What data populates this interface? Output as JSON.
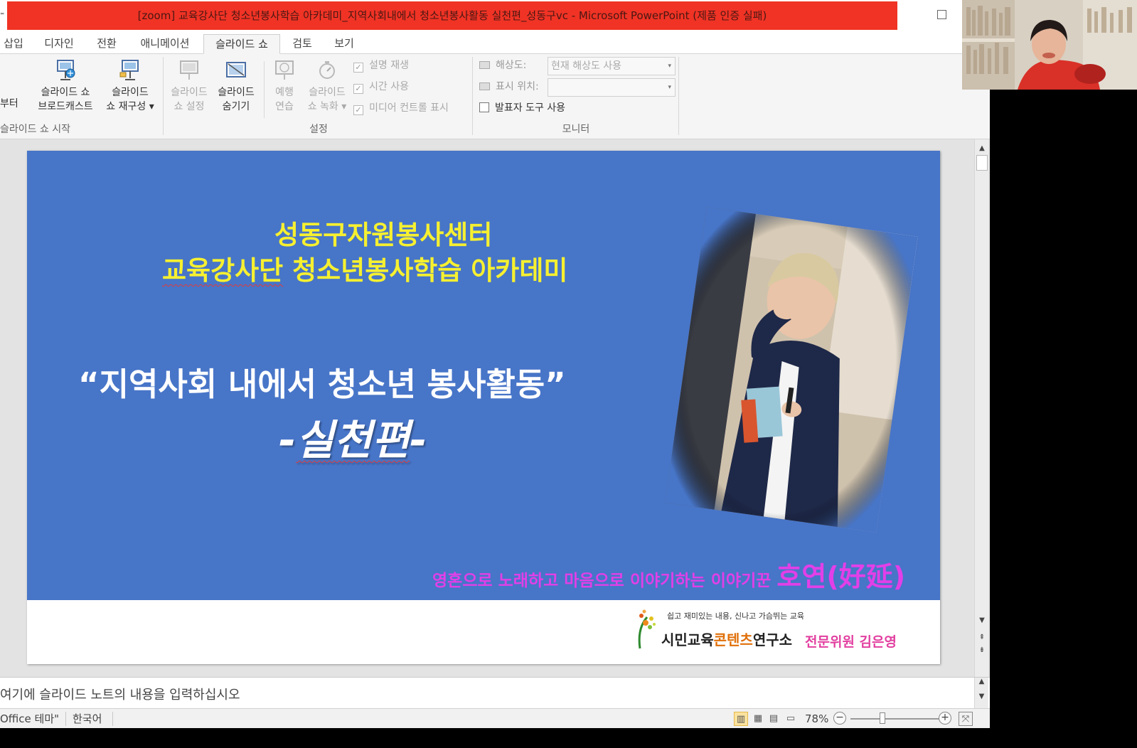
{
  "window": {
    "title": "[zoom] 교육강사단 청소년봉사학습 아카데미_지역사회내에서 청소년봉사활동 실천편_성동구vc  -  Microsoft PowerPoint (제품 인증 실패)",
    "titlebar_color": "#f03325"
  },
  "ribbon": {
    "tabs": [
      {
        "label": "삽입",
        "active": false
      },
      {
        "label": "디자인",
        "active": false
      },
      {
        "label": "전환",
        "active": false
      },
      {
        "label": "애니메이션",
        "active": false
      },
      {
        "label": "슬라이드 쇼",
        "active": true
      },
      {
        "label": "검토",
        "active": false
      },
      {
        "label": "보기",
        "active": false
      }
    ],
    "start_group": {
      "label": "슬라이드 쇼 시작",
      "from_partial": "부터",
      "broadcast": [
        "슬라이드 쇼",
        "브로드캐스트"
      ],
      "custom": [
        "슬라이드",
        "쇼 재구성"
      ]
    },
    "setup_group": {
      "label": "설정",
      "setup_show": [
        "슬라이드",
        "쇼 설정"
      ],
      "hide_slide": [
        "슬라이드",
        "숨기기"
      ],
      "rehearse": [
        "예행",
        "연습"
      ],
      "record": [
        "슬라이드",
        "쇼 녹화"
      ],
      "checks": [
        {
          "label": "설명 재생",
          "checked": true
        },
        {
          "label": "시간 사용",
          "checked": true
        },
        {
          "label": "미디어 컨트롤 표시",
          "checked": true
        }
      ]
    },
    "monitor_group": {
      "label": "모니터",
      "resolution_label": "해상도:",
      "resolution_value": "현재 해상도 사용",
      "showon_label": "표시 위치:",
      "showon_value": "",
      "presenter_view": {
        "label": "발표자 도구 사용",
        "checked": false
      }
    }
  },
  "slide": {
    "background": "#4775c8",
    "line1": "성동구자원봉사센터",
    "line2a": "교육강사단",
    "line2b": " 청소년봉사학습 아카데미",
    "line3": "“지역사회 내에서 청소년 봉사활동”",
    "line4a": "-",
    "line4b": "실천편",
    "line4c": "-",
    "tagline": "영혼으로 노래하고 마음으로 이야기하는 이야기꾼 ",
    "tagline_big": "호연(好延)",
    "logo_tagline": "쉽고 재미있는 내용, 신나고 가슴뛰는 교육",
    "logo_name_a": "시민교육",
    "logo_name_b": "콘텐츠",
    "logo_name_c": "연구소",
    "logo_person": "전문위원  김은영"
  },
  "notes": {
    "placeholder": "여기에 슬라이드 노트의 내용을 입력하십시오"
  },
  "status": {
    "theme": "Office 테마\"",
    "language": "한국어",
    "zoom": "78%",
    "zoom_fraction": 0.78
  }
}
